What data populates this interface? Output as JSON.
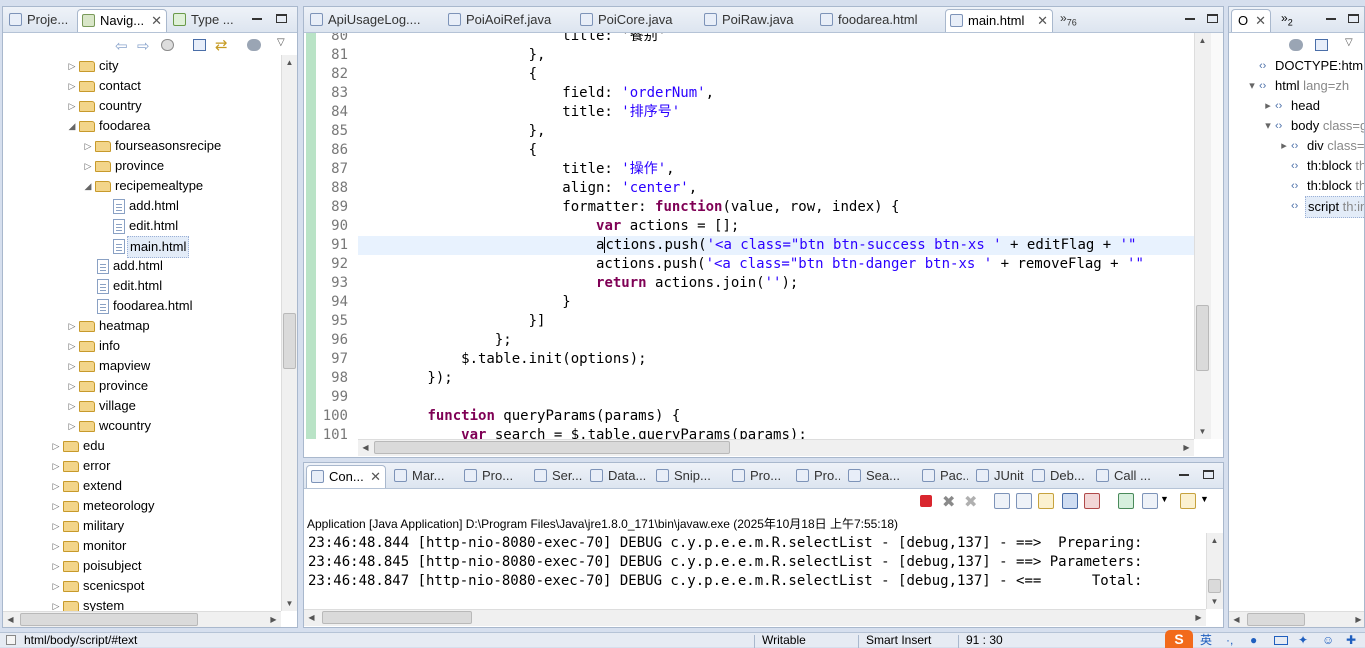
{
  "left_panel": {
    "tabs": [
      {
        "label": "Proje..."
      },
      {
        "label": "Navig..."
      },
      {
        "label": "Type ..."
      }
    ],
    "tree": [
      {
        "label": "city",
        "indent": 1,
        "type": "folder",
        "state": "collapsed"
      },
      {
        "label": "contact",
        "indent": 1,
        "type": "folder",
        "state": "collapsed"
      },
      {
        "label": "country",
        "indent": 1,
        "type": "folder",
        "state": "collapsed"
      },
      {
        "label": "foodarea",
        "indent": 1,
        "type": "folder",
        "state": "expanded"
      },
      {
        "label": "fourseasonsrecipe",
        "indent": 2,
        "type": "folder",
        "state": "collapsed"
      },
      {
        "label": "province",
        "indent": 2,
        "type": "folder",
        "state": "collapsed"
      },
      {
        "label": "recipemealtype",
        "indent": 2,
        "type": "folder",
        "state": "expanded"
      },
      {
        "label": "add.html",
        "indent": 3,
        "type": "file"
      },
      {
        "label": "edit.html",
        "indent": 3,
        "type": "file"
      },
      {
        "label": "main.html",
        "indent": 3,
        "type": "file",
        "selected": true
      },
      {
        "label": "add.html",
        "indent": 2,
        "type": "file"
      },
      {
        "label": "edit.html",
        "indent": 2,
        "type": "file"
      },
      {
        "label": "foodarea.html",
        "indent": 2,
        "type": "file"
      },
      {
        "label": "heatmap",
        "indent": 1,
        "type": "folder",
        "state": "collapsed"
      },
      {
        "label": "info",
        "indent": 1,
        "type": "folder",
        "state": "collapsed"
      },
      {
        "label": "mapview",
        "indent": 1,
        "type": "folder",
        "state": "collapsed"
      },
      {
        "label": "province",
        "indent": 1,
        "type": "folder",
        "state": "collapsed"
      },
      {
        "label": "village",
        "indent": 1,
        "type": "folder",
        "state": "collapsed"
      },
      {
        "label": "wcountry",
        "indent": 1,
        "type": "folder",
        "state": "collapsed"
      },
      {
        "label": "edu",
        "indent": 0,
        "type": "folder",
        "state": "collapsed"
      },
      {
        "label": "error",
        "indent": 0,
        "type": "folder",
        "state": "collapsed"
      },
      {
        "label": "extend",
        "indent": 0,
        "type": "folder",
        "state": "collapsed"
      },
      {
        "label": "meteorology",
        "indent": 0,
        "type": "folder",
        "state": "collapsed"
      },
      {
        "label": "military",
        "indent": 0,
        "type": "folder",
        "state": "collapsed"
      },
      {
        "label": "monitor",
        "indent": 0,
        "type": "folder",
        "state": "collapsed"
      },
      {
        "label": "poisubject",
        "indent": 0,
        "type": "folder",
        "state": "collapsed"
      },
      {
        "label": "scenicspot",
        "indent": 0,
        "type": "folder",
        "state": "collapsed"
      },
      {
        "label": "system",
        "indent": 0,
        "type": "folder",
        "state": "collapsed"
      }
    ]
  },
  "editor": {
    "tabs": [
      {
        "label": "ApiUsageLog...."
      },
      {
        "label": "PoiAoiRef.java"
      },
      {
        "label": "PoiCore.java"
      },
      {
        "label": "PoiRaw.java"
      },
      {
        "label": "foodarea.html"
      },
      {
        "label": "main.html",
        "active": true
      }
    ],
    "overflow_count": "76",
    "lines": [
      {
        "n": "80",
        "html": "                        title: '餐别'"
      },
      {
        "n": "81",
        "html": "                    },"
      },
      {
        "n": "82",
        "html": "                    {"
      },
      {
        "n": "83",
        "html": "                        field: <s>'orderNum'</s>,"
      },
      {
        "n": "84",
        "html": "                        title: <s>'排序号'</s>"
      },
      {
        "n": "85",
        "html": "                    },"
      },
      {
        "n": "86",
        "html": "                    {"
      },
      {
        "n": "87",
        "html": "                        title: <s>'操作'</s>,"
      },
      {
        "n": "88",
        "html": "                        align: <s>'center'</s>,"
      },
      {
        "n": "89",
        "html": "                        formatter: <k>function</k>(value, row, index) {"
      },
      {
        "n": "90",
        "html": "                            <k>var</k> actions = [];"
      },
      {
        "n": "91",
        "html": "                            a<cur></cur>ctions.push(<s>'&lt;a class=\"btn btn-success btn-xs ' </s>+ editFlag + <s>'\"</s>"
      },
      {
        "n": "92",
        "html": "                            actions.push(<s>'&lt;a class=\"btn btn-danger btn-xs ' </s>+ removeFlag + <s>'\"</s>"
      },
      {
        "n": "93",
        "html": "                            <k>return</k> actions.join(<s>''</s>);"
      },
      {
        "n": "94",
        "html": "                        }"
      },
      {
        "n": "95",
        "html": "                    }]"
      },
      {
        "n": "96",
        "html": "                };"
      },
      {
        "n": "97",
        "html": "            $.table.init(options);"
      },
      {
        "n": "98",
        "html": "        });"
      },
      {
        "n": "99",
        "html": ""
      },
      {
        "n": "100",
        "html": "        <k>function</k> queryParams(params) {"
      },
      {
        "n": "101",
        "html": "            <k>var</k> search = $.table.queryParams(params);"
      }
    ],
    "current_line": "91"
  },
  "outline": {
    "tab_label": "O",
    "overflow_count": "2",
    "items": [
      {
        "label": "DOCTYPE:html",
        "extra": "",
        "indent": 0,
        "toggle": ""
      },
      {
        "label": "html",
        "extra": "lang=zh",
        "indent": 0,
        "toggle": "▾"
      },
      {
        "label": "head",
        "extra": "",
        "indent": 1,
        "toggle": "▸"
      },
      {
        "label": "body",
        "extra": "class=g",
        "indent": 1,
        "toggle": "▾"
      },
      {
        "label": "div",
        "extra": "class=",
        "indent": 2,
        "toggle": "▸"
      },
      {
        "label": "th:block",
        "extra": "th",
        "indent": 2,
        "toggle": ""
      },
      {
        "label": "th:block",
        "extra": "th",
        "indent": 2,
        "toggle": ""
      },
      {
        "label": "script",
        "extra": "th:in",
        "indent": 2,
        "toggle": "",
        "selected": true
      }
    ]
  },
  "bottom_panel": {
    "tabs": [
      {
        "label": "Con...",
        "active": true
      },
      {
        "label": "Mar..."
      },
      {
        "label": "Pro..."
      },
      {
        "label": "Ser..."
      },
      {
        "label": "Data..."
      },
      {
        "label": "Snip..."
      },
      {
        "label": "Pro..."
      },
      {
        "label": "Pro..."
      },
      {
        "label": "Sea..."
      },
      {
        "label": "Pac..."
      },
      {
        "label": "JUnit"
      },
      {
        "label": "Deb..."
      },
      {
        "label": "Call ..."
      }
    ],
    "console_title": "Application [Java Application] D:\\Program Files\\Java\\jre1.8.0_171\\bin\\javaw.exe (2025年10月18日 上午7:55:18)",
    "lines": [
      "23:46:48.844 [http-nio-8080-exec-70] DEBUG c.y.p.e.e.m.R.selectList - [debug,137] - ==>  Preparing:",
      "23:46:48.845 [http-nio-8080-exec-70] DEBUG c.y.p.e.e.m.R.selectList - [debug,137] - ==> Parameters:",
      "23:46:48.847 [http-nio-8080-exec-70] DEBUG c.y.p.e.e.m.R.selectList - [debug,137] - <==      Total:"
    ]
  },
  "status_bar": {
    "path": "html/body/script/#text",
    "writable": "Writable",
    "insert_mode": "Smart Insert",
    "position": "91 : 30",
    "ime": "英"
  },
  "colors": {
    "keyword": "#7f0055",
    "string": "#2a00ff",
    "line_highlight": "#e8f2fe",
    "stop_button": "#d9262e"
  }
}
